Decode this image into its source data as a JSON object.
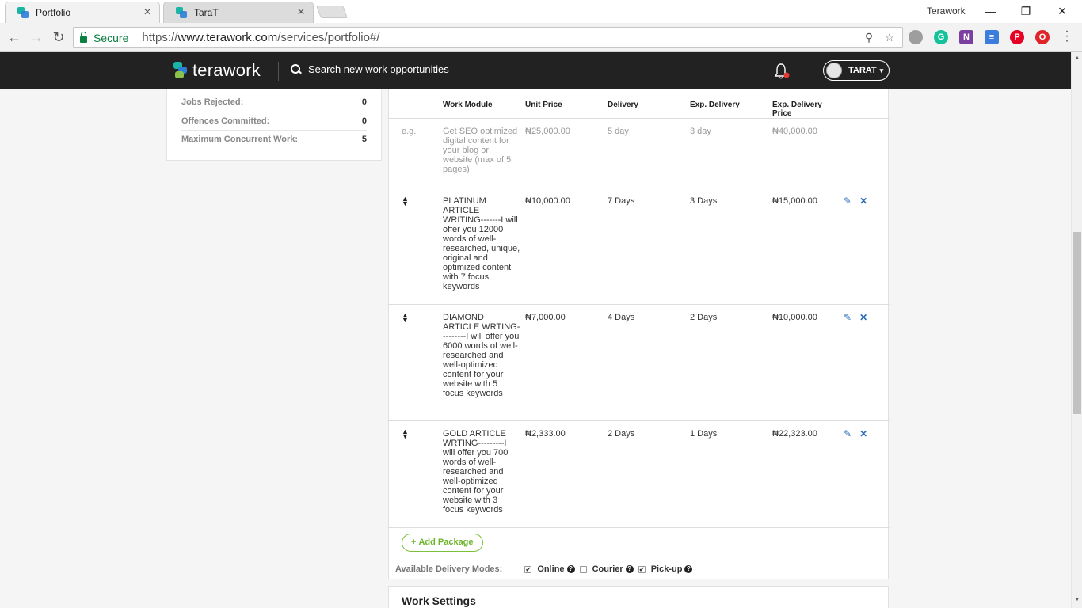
{
  "browser": {
    "tabs": [
      {
        "title": "Portfolio"
      },
      {
        "title": "TaraT"
      }
    ],
    "window_label": "Terawork",
    "secure_label": "Secure",
    "url_prefix": "https://",
    "url_host": "www.terawork.com",
    "url_path": "/services/portfolio#/"
  },
  "site": {
    "logo_text": "terawork",
    "search_placeholder": "Search new work opportunities",
    "user_name": "TARAT",
    "user_caret": "▾"
  },
  "stats": [
    {
      "label": "Jobs Rejected:",
      "value": "0"
    },
    {
      "label": "Offences Committed:",
      "value": "0"
    },
    {
      "label": "Maximum Concurrent Work:",
      "value": "5"
    }
  ],
  "table": {
    "headers": [
      "Work Module",
      "Unit Price",
      "Delivery",
      "Exp. Delivery",
      "Exp. Delivery Price"
    ],
    "example": {
      "marker": "e.g.",
      "module": "Get SEO optimized digital content for your blog or website (max of 5 pages)",
      "unit_price": "₦25,000.00",
      "delivery": "5 day",
      "exp_delivery": "3 day",
      "exp_price": "₦40,000.00"
    },
    "rows": [
      {
        "module": "PLATINUM ARTICLE WRITING-------I will offer you 12000 words of well-researched, unique, original and optimized content with 7 focus keywords",
        "unit_price": "₦10,000.00",
        "delivery": "7 Days",
        "exp_delivery": "3 Days",
        "exp_price": "₦15,000.00"
      },
      {
        "module": "DIAMOND ARTICLE WRTING---------I will offer you 6000 words of well-researched and well-optimized content for your website with 5 focus keywords",
        "unit_price": "₦7,000.00",
        "delivery": "4 Days",
        "exp_delivery": "2 Days",
        "exp_price": "₦10,000.00"
      },
      {
        "module": "GOLD ARTICLE WRTING---------I will offer you 700 words of well-researched and well-optimized content for your website with 3 focus keywords",
        "unit_price": "₦2,333.00",
        "delivery": "2 Days",
        "exp_delivery": "1 Days",
        "exp_price": "₦22,323.00"
      }
    ]
  },
  "add_package_label": "Add Package",
  "delivery_modes": {
    "label": "Available Delivery Modes:",
    "modes": [
      {
        "name": "Online",
        "checked": true
      },
      {
        "name": "Courier",
        "checked": false
      },
      {
        "name": "Pick-up",
        "checked": true
      }
    ]
  },
  "work_settings_title": "Work Settings",
  "colors": {
    "header_bg": "#222222",
    "accent_green": "#6cb52a",
    "action_blue": "#2c6eb5",
    "notification_red": "#e53935"
  }
}
